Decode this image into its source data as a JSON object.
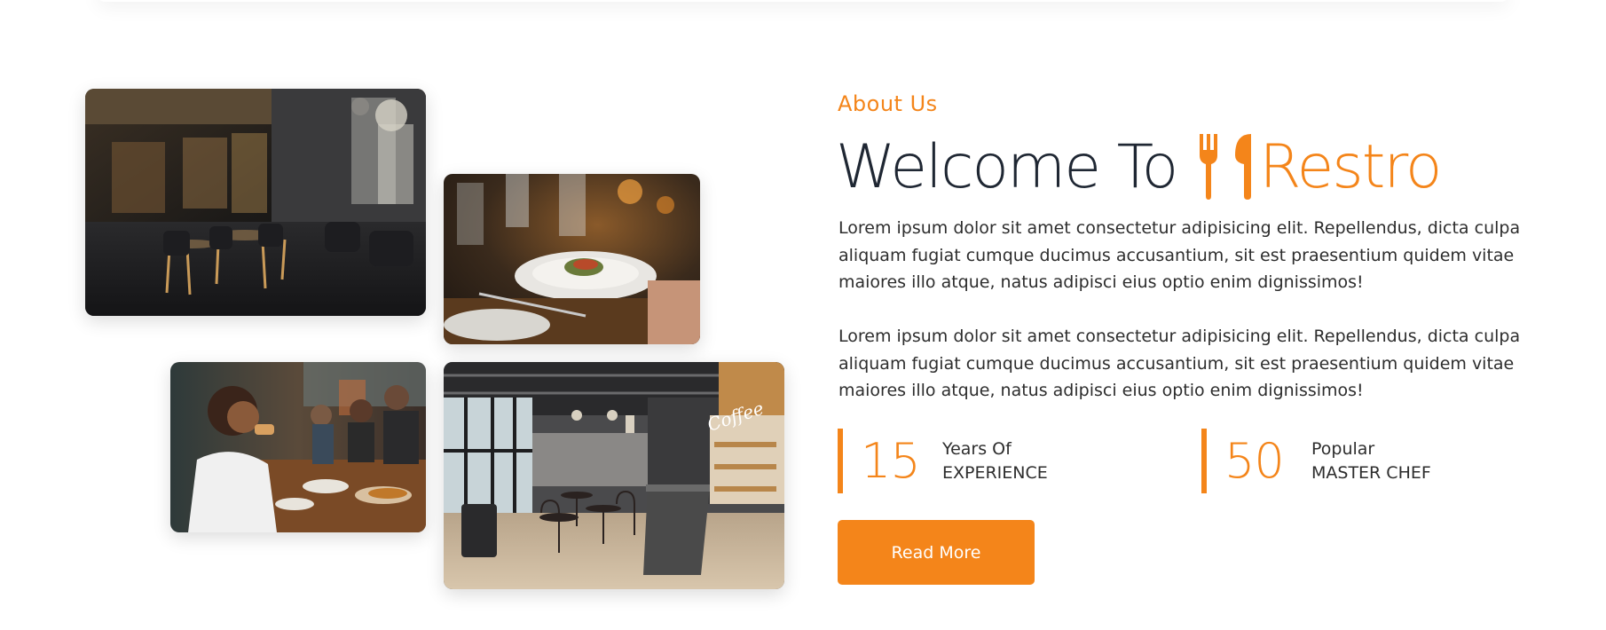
{
  "about": {
    "subtitle": "About Us",
    "headline_prefix": "Welcome To",
    "headline_brand": "Restro",
    "paragraph_1": "Lorem ipsum dolor sit amet consectetur adipisicing elit. Repellendus, dicta culpa aliquam fugiat cumque ducimus accusantium, sit est praesentium quidem vitae maiores illo atque, natus adipisci eius optio enim dignissimos!",
    "paragraph_2": "Lorem ipsum dolor sit amet consectetur adipisicing elit. Repellendus, dicta culpa aliquam fugiat cumque ducimus accusantium, sit est praesentium quidem vitae maiores illo atque, natus adipisci eius optio enim dignissimos!",
    "read_more_label": "Read More"
  },
  "stats": [
    {
      "number": "15",
      "line_1": "Years Of",
      "line_2": "EXPERIENCE"
    },
    {
      "number": "50",
      "line_1": "Popular",
      "line_2": "MASTER CHEF"
    }
  ],
  "icons": {
    "brand_icon": "utensils-icon"
  },
  "colors": {
    "accent": "#F4851A",
    "heading": "#1f2733",
    "body_text": "#2d2d2d",
    "background": "#ffffff"
  }
}
